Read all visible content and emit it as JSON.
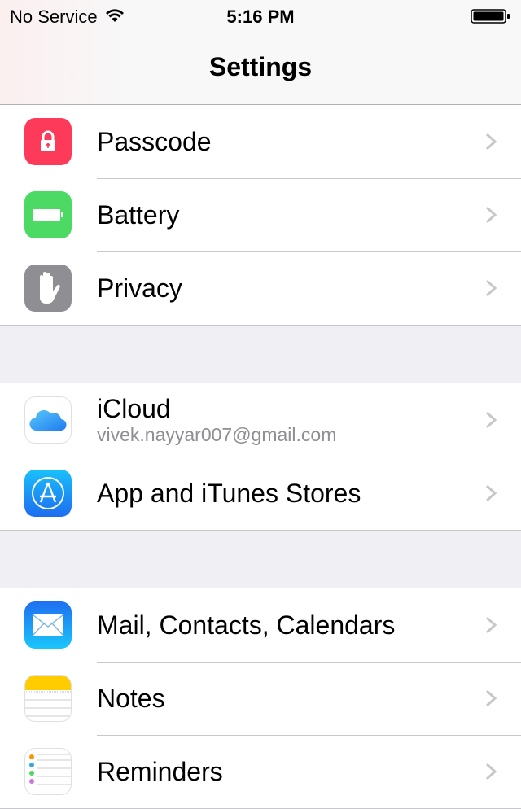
{
  "status_bar": {
    "carrier": "No Service",
    "time": "5:16 PM",
    "wifi_icon": "wifi-icon",
    "battery_icon": "battery-full-icon"
  },
  "nav": {
    "title": "Settings"
  },
  "groups": [
    {
      "items": [
        {
          "label": "Passcode",
          "icon": "lock-icon",
          "color": "#fe3a5b"
        },
        {
          "label": "Battery",
          "icon": "battery-icon",
          "color": "#4cd964"
        },
        {
          "label": "Privacy",
          "icon": "hand-icon",
          "color": "#8e8e93"
        }
      ]
    },
    {
      "items": [
        {
          "label": "iCloud",
          "sublabel": "vivek.nayyar007@gmail.com",
          "icon": "icloud-icon",
          "color": "#ffffff"
        },
        {
          "label": "App and iTunes Stores",
          "icon": "app-store-icon",
          "color": "#1d8bf0"
        }
      ]
    },
    {
      "items": [
        {
          "label": "Mail, Contacts, Calendars",
          "icon": "mail-icon",
          "color": "#1e90f8"
        },
        {
          "label": "Notes",
          "icon": "notes-icon",
          "color": "#ffcc00"
        },
        {
          "label": "Reminders",
          "icon": "reminders-icon",
          "color": "#ffffff"
        }
      ]
    }
  ]
}
